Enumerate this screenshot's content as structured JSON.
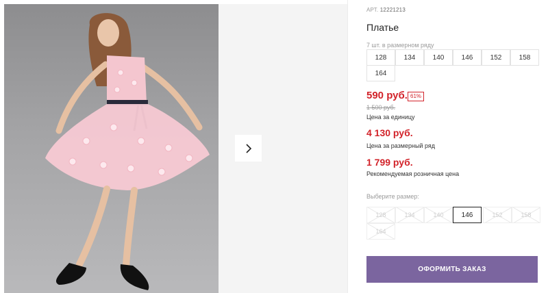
{
  "product": {
    "article_label": "АРТ.",
    "article_number": "12221213",
    "title": "Платье",
    "sizes_in_row_note": "7 шт. в размерном ряду",
    "size_row": [
      "128",
      "134",
      "140",
      "146",
      "152",
      "158",
      "164"
    ]
  },
  "pricing": {
    "unit_price": "590 руб.",
    "discount_badge": "61%",
    "old_price": "1 500 руб.",
    "unit_price_label": "Цена за единицу",
    "row_price": "4 130 руб.",
    "row_price_label": "Цена за размерный ряд",
    "retail_price": "1 799 руб.",
    "retail_price_label": "Рекомендуемая розничная цена"
  },
  "size_select": {
    "prompt": "Выберите размер:",
    "options": [
      {
        "label": "128",
        "state": "disabled"
      },
      {
        "label": "134",
        "state": "disabled"
      },
      {
        "label": "140",
        "state": "disabled"
      },
      {
        "label": "146",
        "state": "selected"
      },
      {
        "label": "152",
        "state": "disabled"
      },
      {
        "label": "158",
        "state": "disabled"
      },
      {
        "label": "164",
        "state": "disabled"
      }
    ]
  },
  "actions": {
    "order_button": "ОФОРМИТЬ ЗАКАЗ",
    "next_icon": "chevron-right-icon"
  },
  "colors": {
    "price_red": "#d2232a",
    "button_purple": "#7b659f"
  }
}
